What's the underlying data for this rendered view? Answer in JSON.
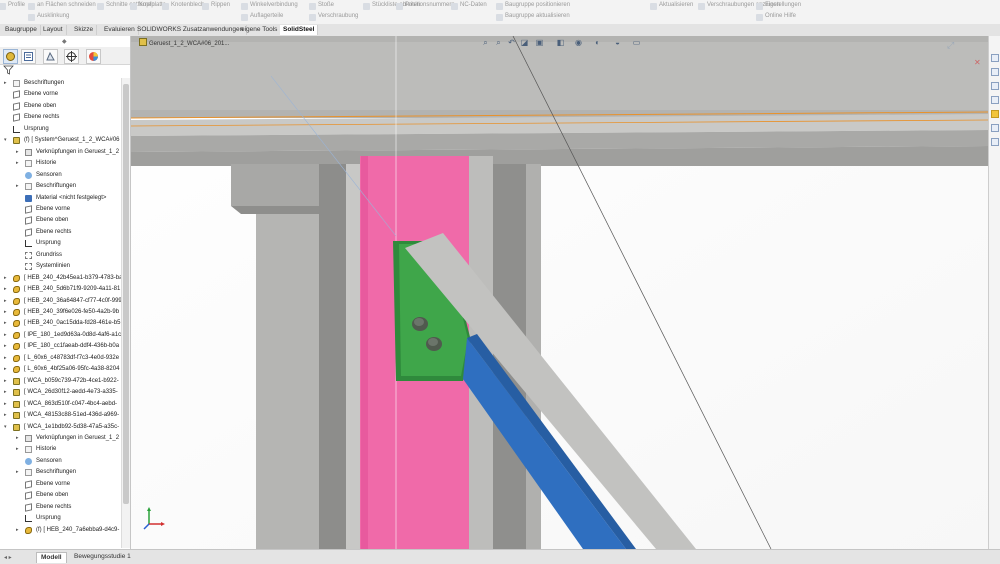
{
  "ribbon": {
    "items": [
      "Profile",
      "an Flächen schneiden",
      "Schnitte entfernen",
      "Kopfplatte",
      "Knotenblech",
      "Rippen",
      "Winkelverbindung",
      "Auflagerteile",
      "Stoße",
      "Verschraubung",
      "Stückliste ableiten",
      "Positionsnummern",
      "NC-Daten",
      "Baugruppe positionieren",
      "Baugruppe aktualisieren",
      "Aktualisieren",
      "Verschraubungen anzeigen",
      "Einstellungen",
      "Online Hilfe",
      "Ausklinkung"
    ]
  },
  "tabs": [
    {
      "label": "Baugruppe",
      "active": false
    },
    {
      "label": "Layout",
      "active": false
    },
    {
      "label": "Skizze",
      "active": false
    },
    {
      "label": "Evaluieren",
      "active": false
    },
    {
      "label": "SOLIDWORKS Zusatzanwendungen",
      "active": false
    },
    {
      "label": "eigene Tools",
      "active": false
    },
    {
      "label": "SolidSteel",
      "active": true
    }
  ],
  "feature_tree": {
    "rows": [
      {
        "label": "Beschriftungen",
        "icon": "annotations-icon",
        "level": 0,
        "arrow": "▸"
      },
      {
        "label": "Ebene vorne",
        "icon": "plane-icon",
        "level": 0,
        "arrow": ""
      },
      {
        "label": "Ebene oben",
        "icon": "plane-icon",
        "level": 0,
        "arrow": ""
      },
      {
        "label": "Ebene rechts",
        "icon": "plane-icon",
        "level": 0,
        "arrow": ""
      },
      {
        "label": "Ursprung",
        "icon": "origin-icon",
        "level": 0,
        "arrow": ""
      },
      {
        "label": "(f) [ System^Geruest_1_2_WCA#06",
        "icon": "assembly-icon",
        "level": 0,
        "arrow": "▾"
      },
      {
        "label": "Verknüpfungen in Geruest_1_2",
        "icon": "mates-icon",
        "level": 1,
        "arrow": "▸"
      },
      {
        "label": "Historie",
        "icon": "history-icon",
        "level": 1,
        "arrow": "▸"
      },
      {
        "label": "Sensoren",
        "icon": "sensor-icon",
        "level": 1,
        "arrow": ""
      },
      {
        "label": "Beschriftungen",
        "icon": "annotations-icon",
        "level": 1,
        "arrow": "▸"
      },
      {
        "label": "Material <nicht festgelegt>",
        "icon": "material-icon",
        "level": 1,
        "arrow": ""
      },
      {
        "label": "Ebene vorne",
        "icon": "plane-icon",
        "level": 1,
        "arrow": ""
      },
      {
        "label": "Ebene oben",
        "icon": "plane-icon",
        "level": 1,
        "arrow": ""
      },
      {
        "label": "Ebene rechts",
        "icon": "plane-icon",
        "level": 1,
        "arrow": ""
      },
      {
        "label": "Ursprung",
        "icon": "origin-icon",
        "level": 1,
        "arrow": ""
      },
      {
        "label": "Grundriss",
        "icon": "grid-icon",
        "level": 1,
        "arrow": ""
      },
      {
        "label": "Systemlinien",
        "icon": "grid-icon",
        "level": 1,
        "arrow": ""
      },
      {
        "label": "[ HEB_240_42b45ea1-b379-4783-ba",
        "icon": "part-icon",
        "level": 0,
        "arrow": "▸"
      },
      {
        "label": "[ HEB_240_5d6b71f9-9209-4a11-81",
        "icon": "part-icon",
        "level": 0,
        "arrow": "▸"
      },
      {
        "label": "[ HEB_240_36a64847-cf77-4c0f-999",
        "icon": "part-icon",
        "level": 0,
        "arrow": "▸"
      },
      {
        "label": "[ HEB_240_39f6e026-fe50-4a2b-9b",
        "icon": "part-icon",
        "level": 0,
        "arrow": "▸"
      },
      {
        "label": "[ HEB_240_0ac15dda-fd28-461e-b5",
        "icon": "part-icon",
        "level": 0,
        "arrow": "▸"
      },
      {
        "label": "[ IPE_180_1ed9d63a-0d8d-4af6-a1c",
        "icon": "part-icon",
        "level": 0,
        "arrow": "▸"
      },
      {
        "label": "[ IPE_180_cc1faeab-ddf4-436b-b0a",
        "icon": "part-icon",
        "level": 0,
        "arrow": "▸"
      },
      {
        "label": "[ L_60x6_c48783df-f7c3-4e0d-932e",
        "icon": "part-icon",
        "level": 0,
        "arrow": "▸"
      },
      {
        "label": "[ L_60x6_4bf25a06-95fc-4a38-8204",
        "icon": "part-icon",
        "level": 0,
        "arrow": "▸"
      },
      {
        "label": "[ WCA_b059c739-472b-4ce1-b922-",
        "icon": "assembly-icon",
        "level": 0,
        "arrow": "▸"
      },
      {
        "label": "[ WCA_26d30f12-aedd-4e73-a335-",
        "icon": "assembly-icon",
        "level": 0,
        "arrow": "▸"
      },
      {
        "label": "[ WCA_863d510f-c047-4bc4-aebd-",
        "icon": "assembly-icon",
        "level": 0,
        "arrow": "▸"
      },
      {
        "label": "[ WCA_48153c88-51ed-436d-a969-",
        "icon": "assembly-icon",
        "level": 0,
        "arrow": "▸"
      },
      {
        "label": "[ WCA_1e1bdb92-5d38-47a5-a35c-",
        "icon": "assembly-icon",
        "level": 0,
        "arrow": "▾"
      },
      {
        "label": "Verknüpfungen in Geruest_1_2",
        "icon": "mates-icon",
        "level": 1,
        "arrow": "▸"
      },
      {
        "label": "Historie",
        "icon": "history-icon",
        "level": 1,
        "arrow": "▸"
      },
      {
        "label": "Sensoren",
        "icon": "sensor-icon",
        "level": 1,
        "arrow": ""
      },
      {
        "label": "Beschriftungen",
        "icon": "annotations-icon",
        "level": 1,
        "arrow": "▸"
      },
      {
        "label": "Ebene vorne",
        "icon": "plane-icon",
        "level": 1,
        "arrow": ""
      },
      {
        "label": "Ebene oben",
        "icon": "plane-icon",
        "level": 1,
        "arrow": ""
      },
      {
        "label": "Ebene rechts",
        "icon": "plane-icon",
        "level": 1,
        "arrow": ""
      },
      {
        "label": "Ursprung",
        "icon": "origin-icon",
        "level": 1,
        "arrow": ""
      },
      {
        "label": "(f) [ HEB_240_7a6ebba9-d4c9-",
        "icon": "part-icon",
        "level": 1,
        "arrow": "▸"
      }
    ]
  },
  "viewport": {
    "breadcrumb": "Geruest_1_2_WCA#06_201...",
    "colors": {
      "background": "#ffffff",
      "beam": "#b8b7b2",
      "column_highlight": "#f06aa9",
      "gusset_plate": "#3fa64a",
      "brace_selected": "#2f6fc0",
      "bolt": "#505a4e",
      "edge_orange": "#e8922c"
    }
  },
  "bottom_tabs": [
    {
      "label": "Modell",
      "active": true
    },
    {
      "label": "Bewegungsstudie 1",
      "active": false
    }
  ]
}
